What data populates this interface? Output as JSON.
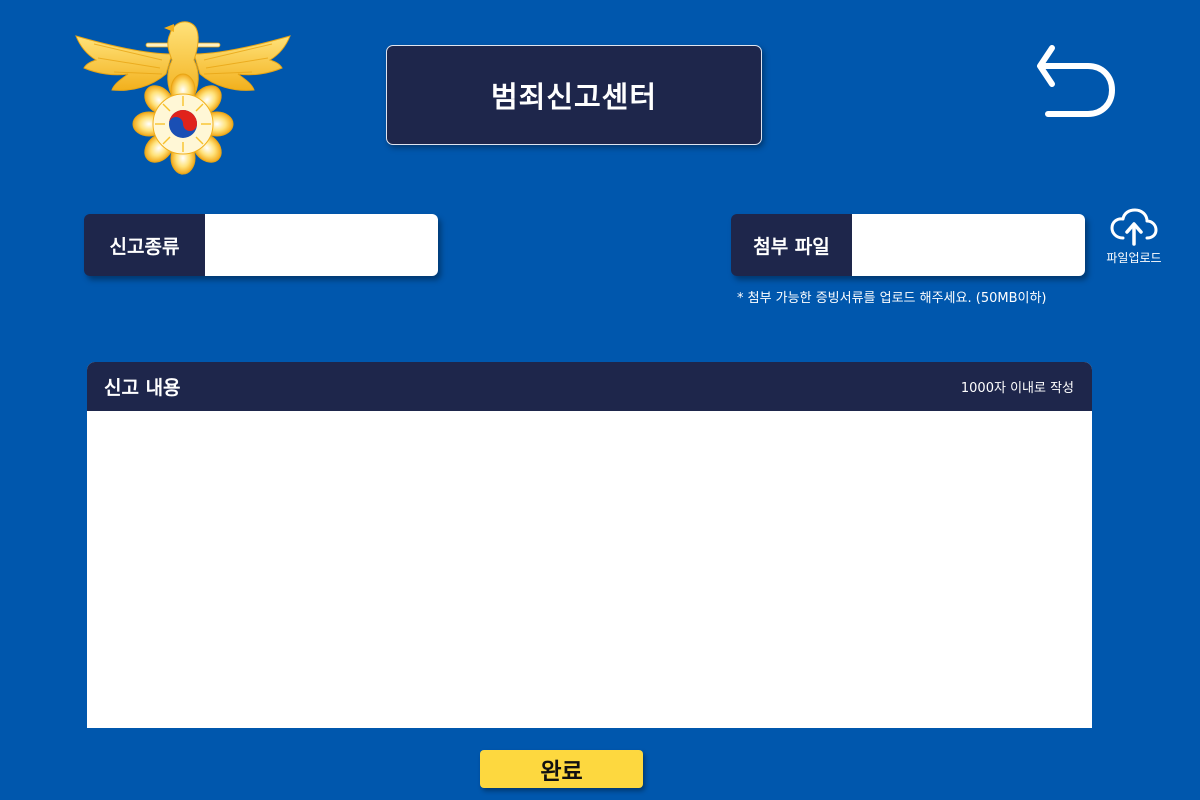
{
  "header": {
    "title": "범죄신고센터",
    "logo_icon": "police-eagle-emblem-icon",
    "back_icon": "back-arrow-icon"
  },
  "form": {
    "report_type": {
      "label": "신고종류",
      "value": ""
    },
    "attach_file": {
      "label": "첨부 파일",
      "value": "",
      "upload_label": "파일업로드",
      "upload_icon": "cloud-upload-icon",
      "note": "* 첨부 가능한 증빙서류를 업로드 해주세요. (50MB이하)"
    },
    "content": {
      "title": "신고 내용",
      "limit_text": "1000자 이내로 작성",
      "value": ""
    },
    "submit_label": "완료"
  },
  "colors": {
    "background": "#0057ad",
    "navy": "#1e264b",
    "submit_yellow": "#fdd83f",
    "emblem_gold": "#f7c22c"
  }
}
